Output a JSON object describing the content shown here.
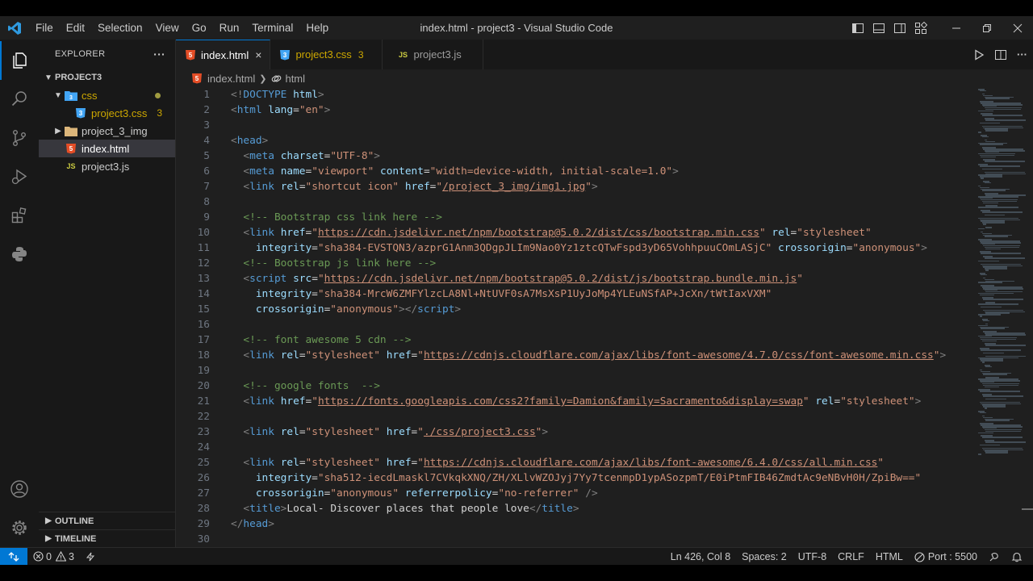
{
  "titlebar": {
    "menu": [
      "File",
      "Edit",
      "Selection",
      "View",
      "Go",
      "Run",
      "Terminal",
      "Help"
    ],
    "window_title": "index.html - project3 - Visual Studio Code"
  },
  "explorer": {
    "title": "EXPLORER",
    "more": "···",
    "folder": "PROJECT3",
    "items": [
      {
        "label": "css",
        "badge": ""
      },
      {
        "label": "project3.css",
        "badge": "3"
      },
      {
        "label": "project_3_img",
        "badge": ""
      },
      {
        "label": "index.html",
        "badge": ""
      },
      {
        "label": "project3.js",
        "badge": ""
      }
    ],
    "outline": "OUTLINE",
    "timeline": "TIMELINE"
  },
  "tabs": [
    {
      "label": "index.html",
      "close": "×"
    },
    {
      "label": "project3.css",
      "count": "3"
    },
    {
      "label": "project3.js"
    }
  ],
  "breadcrumb": {
    "file": "index.html",
    "symbol": "html"
  },
  "icons": {
    "html_file": "5",
    "css_file": "3",
    "js_file": "JS"
  },
  "editor": {
    "lines": [
      {
        "n": "1",
        "parts": [
          [
            "br",
            "<!"
          ],
          [
            "tg",
            "DOCTYPE"
          ],
          [
            "pl",
            " "
          ],
          [
            "at",
            "html"
          ],
          [
            "br",
            ">"
          ]
        ]
      },
      {
        "n": "2",
        "parts": [
          [
            "br",
            "<"
          ],
          [
            "tg",
            "html"
          ],
          [
            "pl",
            " "
          ],
          [
            "at",
            "lang"
          ],
          [
            "pl",
            "="
          ],
          [
            "st",
            "\"en\""
          ],
          [
            "br",
            ">"
          ]
        ]
      },
      {
        "n": "3",
        "parts": []
      },
      {
        "n": "4",
        "parts": [
          [
            "br",
            "<"
          ],
          [
            "tg",
            "head"
          ],
          [
            "br",
            ">"
          ]
        ]
      },
      {
        "n": "5",
        "parts": [
          [
            "pl",
            "  "
          ],
          [
            "br",
            "<"
          ],
          [
            "tg",
            "meta"
          ],
          [
            "pl",
            " "
          ],
          [
            "at",
            "charset"
          ],
          [
            "pl",
            "="
          ],
          [
            "st",
            "\"UTF-8\""
          ],
          [
            "br",
            ">"
          ]
        ]
      },
      {
        "n": "6",
        "parts": [
          [
            "pl",
            "  "
          ],
          [
            "br",
            "<"
          ],
          [
            "tg",
            "meta"
          ],
          [
            "pl",
            " "
          ],
          [
            "at",
            "name"
          ],
          [
            "pl",
            "="
          ],
          [
            "st",
            "\"viewport\""
          ],
          [
            "pl",
            " "
          ],
          [
            "at",
            "content"
          ],
          [
            "pl",
            "="
          ],
          [
            "st",
            "\"width=device-width, initial-scale=1.0\""
          ],
          [
            "br",
            ">"
          ]
        ]
      },
      {
        "n": "7",
        "parts": [
          [
            "pl",
            "  "
          ],
          [
            "br",
            "<"
          ],
          [
            "tg",
            "link"
          ],
          [
            "pl",
            " "
          ],
          [
            "at",
            "rel"
          ],
          [
            "pl",
            "="
          ],
          [
            "st",
            "\"shortcut icon\""
          ],
          [
            "pl",
            " "
          ],
          [
            "at",
            "href"
          ],
          [
            "pl",
            "="
          ],
          [
            "st",
            "\""
          ],
          [
            "lk",
            "/project_3_img/img1.jpg"
          ],
          [
            "st",
            "\""
          ],
          [
            "br",
            ">"
          ]
        ]
      },
      {
        "n": "8",
        "parts": []
      },
      {
        "n": "9",
        "parts": [
          [
            "pl",
            "  "
          ],
          [
            "cm",
            "<!-- Bootstrap css link here -->"
          ]
        ]
      },
      {
        "n": "10",
        "parts": [
          [
            "pl",
            "  "
          ],
          [
            "br",
            "<"
          ],
          [
            "tg",
            "link"
          ],
          [
            "pl",
            " "
          ],
          [
            "at",
            "href"
          ],
          [
            "pl",
            "="
          ],
          [
            "st",
            "\""
          ],
          [
            "lk",
            "https://cdn.jsdelivr.net/npm/bootstrap@5.0.2/dist/css/bootstrap.min.css"
          ],
          [
            "st",
            "\""
          ],
          [
            "pl",
            " "
          ],
          [
            "at",
            "rel"
          ],
          [
            "pl",
            "="
          ],
          [
            "st",
            "\"stylesheet\""
          ]
        ]
      },
      {
        "n": "11",
        "parts": [
          [
            "pl",
            "    "
          ],
          [
            "at",
            "integrity"
          ],
          [
            "pl",
            "="
          ],
          [
            "st",
            "\"sha384-EVSTQN3/azprG1Anm3QDgpJLIm9Nao0Yz1ztcQTwFspd3yD65VohhpuuCOmLASjC\""
          ],
          [
            "pl",
            " "
          ],
          [
            "at",
            "crossorigin"
          ],
          [
            "pl",
            "="
          ],
          [
            "st",
            "\"anonymous\""
          ],
          [
            "br",
            ">"
          ]
        ]
      },
      {
        "n": "12",
        "parts": [
          [
            "pl",
            "  "
          ],
          [
            "cm",
            "<!-- Bootstrap js link here -->"
          ]
        ]
      },
      {
        "n": "13",
        "parts": [
          [
            "pl",
            "  "
          ],
          [
            "br",
            "<"
          ],
          [
            "tg",
            "script"
          ],
          [
            "pl",
            " "
          ],
          [
            "at",
            "src"
          ],
          [
            "pl",
            "="
          ],
          [
            "st",
            "\""
          ],
          [
            "lk",
            "https://cdn.jsdelivr.net/npm/bootstrap@5.0.2/dist/js/bootstrap.bundle.min.js"
          ],
          [
            "st",
            "\""
          ]
        ]
      },
      {
        "n": "14",
        "parts": [
          [
            "pl",
            "    "
          ],
          [
            "at",
            "integrity"
          ],
          [
            "pl",
            "="
          ],
          [
            "st",
            "\"sha384-MrcW6ZMFYlzcLA8Nl+NtUVF0sA7MsXsP1UyJoMp4YLEuNSfAP+JcXn/tWtIaxVXM\""
          ]
        ]
      },
      {
        "n": "15",
        "parts": [
          [
            "pl",
            "    "
          ],
          [
            "at",
            "crossorigin"
          ],
          [
            "pl",
            "="
          ],
          [
            "st",
            "\"anonymous\""
          ],
          [
            "br",
            "></"
          ],
          [
            "tg",
            "script"
          ],
          [
            "br",
            ">"
          ]
        ]
      },
      {
        "n": "16",
        "parts": []
      },
      {
        "n": "17",
        "parts": [
          [
            "pl",
            "  "
          ],
          [
            "cm",
            "<!-- font awesome 5 cdn -->"
          ]
        ]
      },
      {
        "n": "18",
        "parts": [
          [
            "pl",
            "  "
          ],
          [
            "br",
            "<"
          ],
          [
            "tg",
            "link"
          ],
          [
            "pl",
            " "
          ],
          [
            "at",
            "rel"
          ],
          [
            "pl",
            "="
          ],
          [
            "st",
            "\"stylesheet\""
          ],
          [
            "pl",
            " "
          ],
          [
            "at",
            "href"
          ],
          [
            "pl",
            "="
          ],
          [
            "st",
            "\""
          ],
          [
            "lk",
            "https://cdnjs.cloudflare.com/ajax/libs/font-awesome/4.7.0/css/font-awesome.min.css"
          ],
          [
            "st",
            "\""
          ],
          [
            "br",
            ">"
          ]
        ]
      },
      {
        "n": "19",
        "parts": []
      },
      {
        "n": "20",
        "parts": [
          [
            "pl",
            "  "
          ],
          [
            "cm",
            "<!-- google fonts  -->"
          ]
        ]
      },
      {
        "n": "21",
        "parts": [
          [
            "pl",
            "  "
          ],
          [
            "br",
            "<"
          ],
          [
            "tg",
            "link"
          ],
          [
            "pl",
            " "
          ],
          [
            "at",
            "href"
          ],
          [
            "pl",
            "="
          ],
          [
            "st",
            "\""
          ],
          [
            "lk",
            "https://fonts.googleapis.com/css2?family=Damion&family=Sacramento&display=swap"
          ],
          [
            "st",
            "\""
          ],
          [
            "pl",
            " "
          ],
          [
            "at",
            "rel"
          ],
          [
            "pl",
            "="
          ],
          [
            "st",
            "\"stylesheet\""
          ],
          [
            "br",
            ">"
          ]
        ]
      },
      {
        "n": "22",
        "parts": []
      },
      {
        "n": "23",
        "parts": [
          [
            "pl",
            "  "
          ],
          [
            "br",
            "<"
          ],
          [
            "tg",
            "link"
          ],
          [
            "pl",
            " "
          ],
          [
            "at",
            "rel"
          ],
          [
            "pl",
            "="
          ],
          [
            "st",
            "\"stylesheet\""
          ],
          [
            "pl",
            " "
          ],
          [
            "at",
            "href"
          ],
          [
            "pl",
            "="
          ],
          [
            "st",
            "\""
          ],
          [
            "lk",
            "./css/project3.css"
          ],
          [
            "st",
            "\""
          ],
          [
            "br",
            ">"
          ]
        ]
      },
      {
        "n": "24",
        "parts": []
      },
      {
        "n": "25",
        "parts": [
          [
            "pl",
            "  "
          ],
          [
            "br",
            "<"
          ],
          [
            "tg",
            "link"
          ],
          [
            "pl",
            " "
          ],
          [
            "at",
            "rel"
          ],
          [
            "pl",
            "="
          ],
          [
            "st",
            "\"stylesheet\""
          ],
          [
            "pl",
            " "
          ],
          [
            "at",
            "href"
          ],
          [
            "pl",
            "="
          ],
          [
            "st",
            "\""
          ],
          [
            "lk",
            "https://cdnjs.cloudflare.com/ajax/libs/font-awesome/6.4.0/css/all.min.css"
          ],
          [
            "st",
            "\""
          ]
        ]
      },
      {
        "n": "26",
        "parts": [
          [
            "pl",
            "    "
          ],
          [
            "at",
            "integrity"
          ],
          [
            "pl",
            "="
          ],
          [
            "st",
            "\"sha512-iecdLmaskl7CVkqkXNQ/ZH/XLlvWZOJyj7Yy7tcenmpD1ypASozpmT/E0iPtmFIB46ZmdtAc9eNBvH0H/ZpiBw==\""
          ]
        ]
      },
      {
        "n": "27",
        "parts": [
          [
            "pl",
            "    "
          ],
          [
            "at",
            "crossorigin"
          ],
          [
            "pl",
            "="
          ],
          [
            "st",
            "\"anonymous\""
          ],
          [
            "pl",
            " "
          ],
          [
            "at",
            "referrerpolicy"
          ],
          [
            "pl",
            "="
          ],
          [
            "st",
            "\"no-referrer\""
          ],
          [
            "pl",
            " "
          ],
          [
            "br",
            "/>"
          ]
        ]
      },
      {
        "n": "28",
        "parts": [
          [
            "pl",
            "  "
          ],
          [
            "br",
            "<"
          ],
          [
            "tg",
            "title"
          ],
          [
            "br",
            ">"
          ],
          [
            "pl",
            "Local- Discover places that people love"
          ],
          [
            "br",
            "</"
          ],
          [
            "tg",
            "title"
          ],
          [
            "br",
            ">"
          ]
        ]
      },
      {
        "n": "29",
        "parts": [
          [
            "br",
            "</"
          ],
          [
            "tg",
            "head"
          ],
          [
            "br",
            ">"
          ]
        ]
      },
      {
        "n": "30",
        "parts": []
      }
    ]
  },
  "statusbar": {
    "errors": "0",
    "warnings": "3",
    "position": "Ln 426, Col 8",
    "spaces": "Spaces: 2",
    "encoding": "UTF-8",
    "eol": "CRLF",
    "language": "HTML",
    "port": "Port : 5500"
  },
  "colors": {
    "accent": "#0078d4",
    "warning": "#cca700",
    "html_icon": "#e44d26",
    "css_icon": "#42a5f5",
    "js_icon": "#cbcb41",
    "folder_icon": "#dcb67a"
  }
}
